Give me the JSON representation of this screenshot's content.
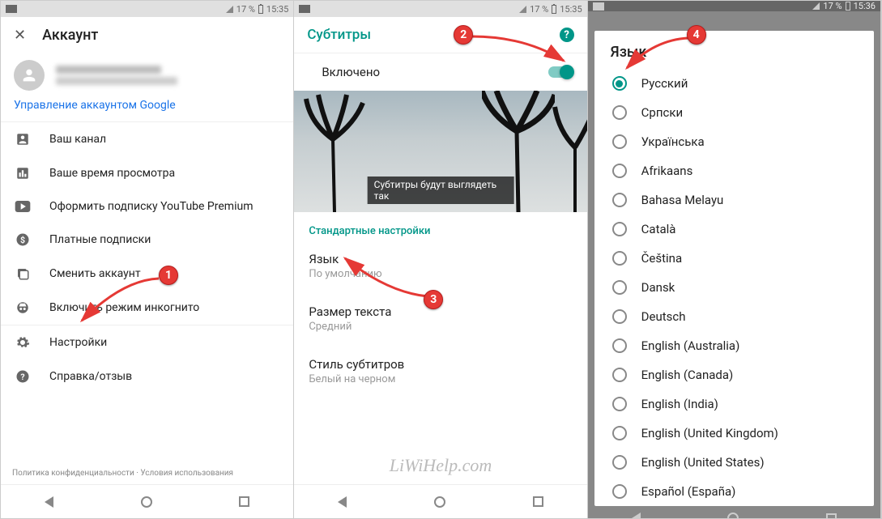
{
  "status": {
    "percent": "17 %",
    "time1": "15:35",
    "time3": "15:36"
  },
  "phone1": {
    "title": "Аккаунт",
    "manage": "Управление аккаунтом Google",
    "items": [
      "Ваш канал",
      "Ваше время просмотра",
      "Оформить подписку YouTube Premium",
      "Платные подписки",
      "Сменить аккаунт",
      "Включить режим инкогнито"
    ],
    "settings": "Настройки",
    "help": "Справка/отзыв",
    "footer": "Политика конфиденциальности  ·  Условия использования"
  },
  "phone2": {
    "title": "Субтитры",
    "enabled": "Включено",
    "caption": "Субтитры будут выглядеть так",
    "section": "Стандартные настройки",
    "lang_t": "Язык",
    "lang_s": "По умолчанию",
    "size_t": "Размер текста",
    "size_s": "Средний",
    "style_t": "Стиль субтитров",
    "style_s": "Белый на черном",
    "watermark": "LiWiHelp.com"
  },
  "phone3": {
    "title": "Язык",
    "langs": [
      "Русский",
      "Српски",
      "Українська",
      "Afrikaans",
      "Bahasa Melayu",
      "Català",
      "Čeština",
      "Dansk",
      "Deutsch",
      "English (Australia)",
      "English (Canada)",
      "English (India)",
      "English (United Kingdom)",
      "English (United States)",
      "Español (España)"
    ],
    "selected": 0
  },
  "badges": {
    "b1": "1",
    "b2": "2",
    "b3": "3",
    "b4": "4"
  }
}
